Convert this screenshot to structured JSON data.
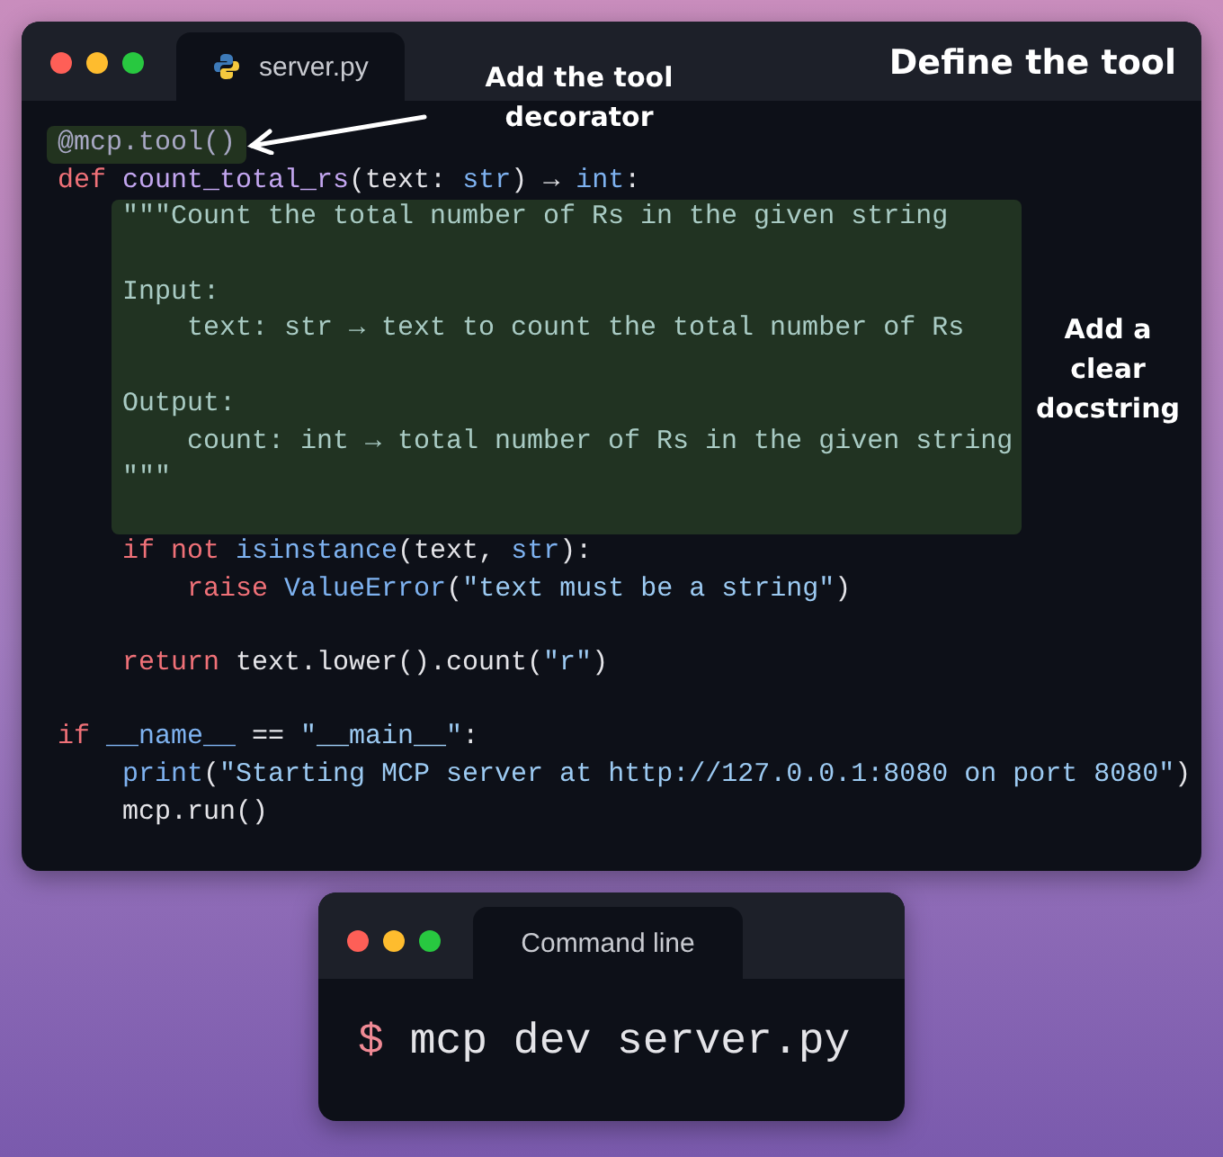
{
  "editor": {
    "tab": "server.py",
    "heading": "Define the tool",
    "code": [
      {
        "kind": "decorator",
        "tokens": [
          {
            "kind": "decorator",
            "text": "@mcp.tool()"
          }
        ]
      },
      {
        "kind": "code",
        "tokens": [
          {
            "kind": "keyword",
            "text": "def"
          },
          {
            "kind": "function",
            "text": " count_total_rs"
          },
          {
            "kind": "plain",
            "text": "(text: "
          },
          {
            "kind": "builtin",
            "text": "str"
          },
          {
            "kind": "plain",
            "text": ") → "
          },
          {
            "kind": "builtin",
            "text": "int"
          },
          {
            "kind": "plain",
            "text": ":"
          }
        ]
      },
      {
        "kind": "docstring",
        "lines": [
          {
            "kind": "code",
            "tokens": [
              {
                "kind": "doc",
                "text": "\"\"\"Count the total number of Rs in the given string"
              }
            ]
          },
          {
            "kind": "blank"
          },
          {
            "kind": "code",
            "tokens": [
              {
                "kind": "doc",
                "text": "Input:"
              }
            ]
          },
          {
            "kind": "code",
            "tokens": [
              {
                "kind": "doc",
                "text": "    text: str → text to count the total number of Rs"
              }
            ]
          },
          {
            "kind": "blank"
          },
          {
            "kind": "code",
            "tokens": [
              {
                "kind": "doc",
                "text": "Output:"
              }
            ]
          },
          {
            "kind": "code",
            "tokens": [
              {
                "kind": "doc",
                "text": "    count: int → total number of Rs in the given string"
              }
            ]
          },
          {
            "kind": "code",
            "tokens": [
              {
                "kind": "doc",
                "text": "\"\"\""
              }
            ]
          }
        ]
      },
      {
        "kind": "code",
        "tokens": [
          {
            "kind": "keyword",
            "text": "    if not"
          },
          {
            "kind": "builtin",
            "text": " isinstance"
          },
          {
            "kind": "plain",
            "text": "(text, "
          },
          {
            "kind": "builtin",
            "text": "str"
          },
          {
            "kind": "plain",
            "text": "):"
          }
        ]
      },
      {
        "kind": "code",
        "tokens": [
          {
            "kind": "keyword",
            "text": "        raise"
          },
          {
            "kind": "builtin",
            "text": " ValueError"
          },
          {
            "kind": "plain",
            "text": "("
          },
          {
            "kind": "string",
            "text": "\"text must be a string\""
          },
          {
            "kind": "plain",
            "text": ")"
          }
        ]
      },
      {
        "kind": "blank"
      },
      {
        "kind": "code",
        "tokens": [
          {
            "kind": "keyword",
            "text": "    return"
          },
          {
            "kind": "plain",
            "text": " text.lower().count("
          },
          {
            "kind": "string",
            "text": "\"r\""
          },
          {
            "kind": "plain",
            "text": ")"
          }
        ]
      },
      {
        "kind": "blank"
      },
      {
        "kind": "code",
        "tokens": [
          {
            "kind": "keyword",
            "text": "if"
          },
          {
            "kind": "builtin",
            "text": " __name__"
          },
          {
            "kind": "plain",
            "text": " == "
          },
          {
            "kind": "string",
            "text": "\"__main__\""
          },
          {
            "kind": "plain",
            "text": ":"
          }
        ]
      },
      {
        "kind": "code",
        "tokens": [
          {
            "kind": "builtin",
            "text": "    print"
          },
          {
            "kind": "plain",
            "text": "("
          },
          {
            "kind": "string",
            "text": "\"Starting MCP server at http://127.0.0.1:8080 on port 8080\""
          },
          {
            "kind": "plain",
            "text": ")"
          }
        ]
      },
      {
        "kind": "code",
        "tokens": [
          {
            "kind": "plain",
            "text": "    mcp.run()"
          }
        ]
      }
    ],
    "annotations": [
      "Add the tool decorator",
      "Add a clear docstring"
    ]
  },
  "terminal": {
    "tab": "Command line",
    "prompt": "$",
    "command": "mcp dev server.py"
  }
}
